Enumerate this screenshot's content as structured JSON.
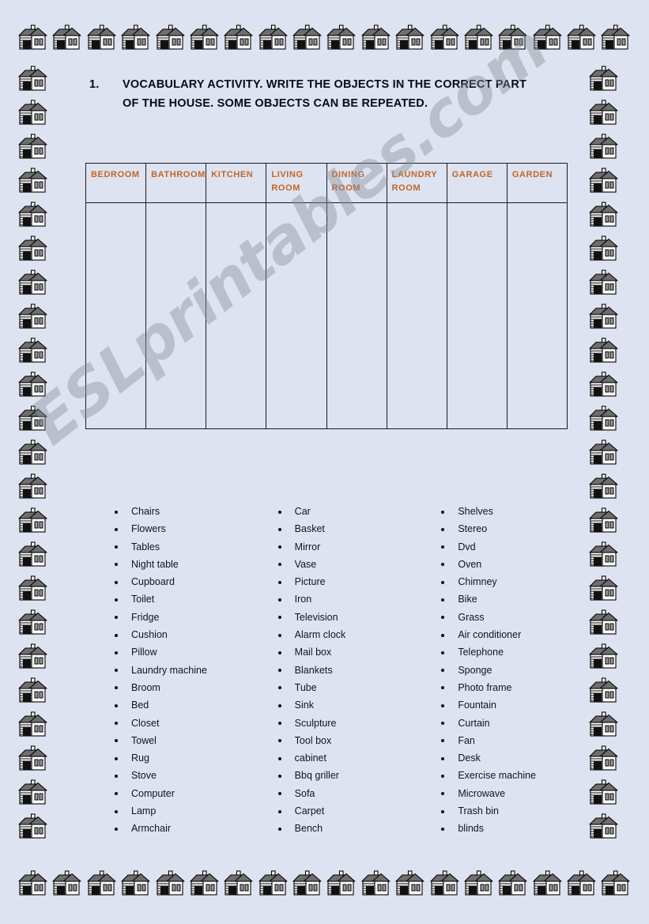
{
  "page": {
    "background_color": "#dde3f0",
    "watermark": "ESLprintables.com"
  },
  "instruction": {
    "number": "1.",
    "text": "VOCABULARY ACTIVITY. WRITE THE OBJECTS IN THE CORRECT PART OF THE HOUSE. SOME OBJECTS CAN BE REPEATED."
  },
  "table": {
    "header_color": "#c46526",
    "headers": [
      "BEDROOM",
      "BATHROOM",
      "KITCHEN",
      "LIVING ROOM",
      "DINING ROOM",
      "LAUNDRY ROOM",
      "GARAGE",
      "GARDEN"
    ],
    "rows": [
      [
        "",
        "",
        "",
        "",
        "",
        "",
        "",
        ""
      ]
    ]
  },
  "word_lists": {
    "columns": [
      {
        "items": [
          "Chairs",
          "Flowers",
          "Tables",
          "Night table",
          "Cupboard",
          "Toilet",
          "Fridge",
          "Cushion",
          "Pillow",
          "Laundry machine",
          "Broom",
          "Bed",
          "Closet",
          "Towel",
          "Rug",
          "Stove",
          "Computer",
          "Lamp",
          "Armchair"
        ]
      },
      {
        "items": [
          "Car",
          "Basket",
          "Mirror",
          "Vase",
          "Picture",
          "Iron",
          "Television",
          "Alarm clock",
          "Mail box",
          "Blankets",
          "Tube",
          "Sink",
          "Sculpture",
          "Tool box",
          "cabinet",
          "Bbq griller",
          "Sofa",
          "Carpet",
          "Bench"
        ]
      },
      {
        "items": [
          "Shelves",
          "Stereo",
          "Dvd",
          "Oven",
          "Chimney",
          "Bike",
          "Grass",
          "Air conditioner",
          "Telephone",
          "Sponge",
          "Photo frame",
          "Fountain",
          "Curtain",
          "Fan",
          "Desk",
          "Exercise machine",
          "Microwave",
          "Trash bin",
          "blinds"
        ]
      }
    ]
  },
  "decoration": {
    "icon": "house-icon",
    "top_row_count": 18,
    "bottom_row_count": 18,
    "left_col_count": 23,
    "right_col_count": 23,
    "roof_color": "#6e6e6e",
    "wall_color": "#ffffff",
    "outline_color": "#000000"
  }
}
